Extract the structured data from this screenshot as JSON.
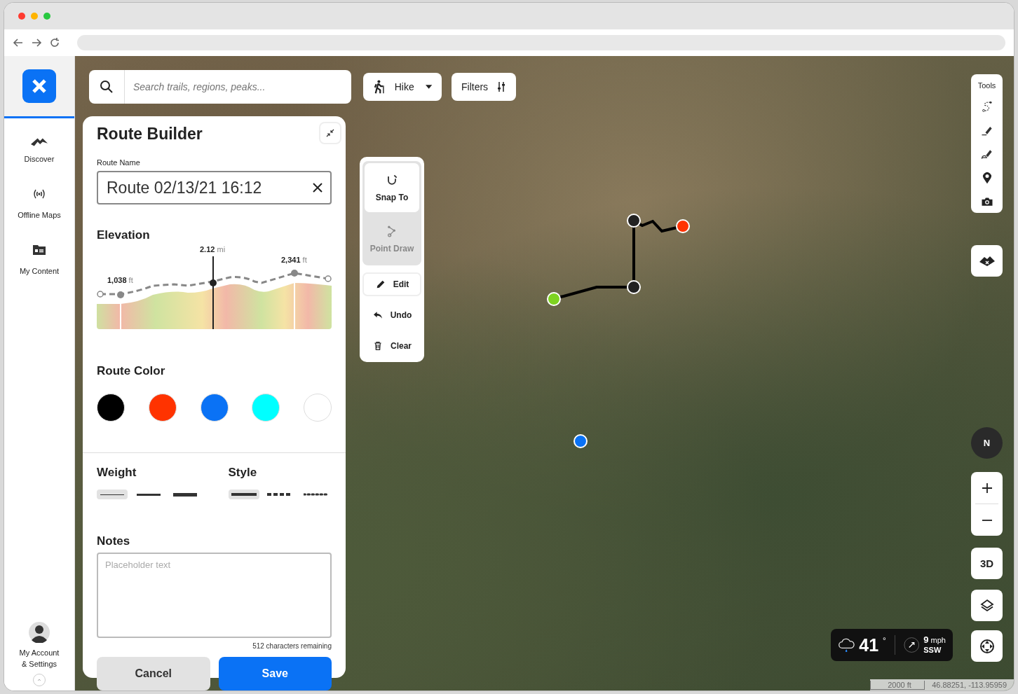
{
  "sidebar": {
    "items": [
      {
        "label": "Discover",
        "selected": false
      },
      {
        "label": "Offline Maps",
        "selected": false
      },
      {
        "label": "My Content",
        "selected": false
      }
    ],
    "account": {
      "label": "My Account & Settings"
    }
  },
  "search": {
    "placeholder": "Search trails, regions, peaks..."
  },
  "activity": {
    "label": "Hike"
  },
  "filters": {
    "label": "Filters"
  },
  "route_builder": {
    "title": "Route Builder",
    "name_label": "Route Name",
    "name_value": "Route 02/13/21 16:12",
    "elevation": {
      "title": "Elevation",
      "distance_value": "2.12",
      "distance_unit": "mi",
      "min_value": "1,038",
      "min_unit": "ft",
      "max_value": "2,341",
      "max_unit": "ft"
    },
    "color_title": "Route Color",
    "colors": [
      {
        "color": "#000000",
        "selected": false
      },
      {
        "color": "#ff3300",
        "selected": false
      },
      {
        "color": "#0a72f5",
        "selected": false
      },
      {
        "color": "#00ffff",
        "selected": false
      },
      {
        "color": "#ffffff",
        "selected": false
      }
    ],
    "weight_title": "Weight",
    "weights": [
      {
        "kind": "thin",
        "selected": true
      },
      {
        "kind": "medium",
        "selected": false
      },
      {
        "kind": "thick",
        "selected": false
      }
    ],
    "style_title": "Style",
    "styles": [
      {
        "kind": "solid",
        "selected": true
      },
      {
        "kind": "dashed",
        "selected": false
      },
      {
        "kind": "dotted",
        "selected": false
      }
    ],
    "notes_title": "Notes",
    "notes_placeholder": "Placeholder text",
    "notes_counter": "512 characters remaining",
    "cancel": "Cancel",
    "save": "Save"
  },
  "draw_modes": [
    {
      "label": "Snap To",
      "selected": true
    },
    {
      "label": "Point Draw",
      "selected": false
    }
  ],
  "draw_actions": [
    {
      "label": "Edit",
      "selected": true
    },
    {
      "label": "Undo",
      "selected": false
    },
    {
      "label": "Clear",
      "selected": false
    }
  ],
  "tools": {
    "title": "Tools"
  },
  "compass": {
    "label": "N"
  },
  "view_3d": "3D",
  "weather": {
    "temperature": "41",
    "degree": "°",
    "wind_speed": "9",
    "wind_unit": "mph",
    "wind_direction": "SSW"
  },
  "scale": "2000 ft",
  "coordinates": "46.88251, -113.95959"
}
